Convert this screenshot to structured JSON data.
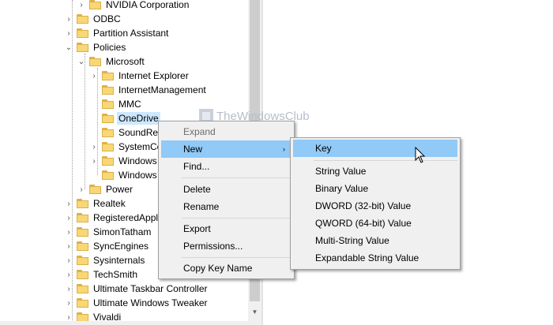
{
  "tree": {
    "items": [
      {
        "label": "NVIDIA Corporation"
      },
      {
        "label": "ODBC"
      },
      {
        "label": "Partition Assistant"
      },
      {
        "label": "Policies"
      },
      {
        "label": "Microsoft"
      },
      {
        "label": "Internet Explorer"
      },
      {
        "label": "InternetManagement"
      },
      {
        "label": "MMC"
      },
      {
        "label": "OneDrive"
      },
      {
        "label": "SoundRe"
      },
      {
        "label": "SystemCe"
      },
      {
        "label": "Windows"
      },
      {
        "label": "Windows"
      },
      {
        "label": "Power"
      },
      {
        "label": "Realtek"
      },
      {
        "label": "RegisteredAppl"
      },
      {
        "label": "SimonTatham"
      },
      {
        "label": "SyncEngines"
      },
      {
        "label": "Sysinternals"
      },
      {
        "label": "TechSmith"
      },
      {
        "label": "Ultimate Taskbar Controller"
      },
      {
        "label": "Ultimate Windows Tweaker"
      },
      {
        "label": "Vivaldi"
      }
    ],
    "chevron_collapsed": "›",
    "chevron_expanded": "⌄"
  },
  "watermark": {
    "text": "TheWindowsClub"
  },
  "context_menu": {
    "expand": "Expand",
    "new": "New",
    "find": "Find...",
    "delete": "Delete",
    "rename": "Rename",
    "export": "Export",
    "permissions": "Permissions...",
    "copy_key_name": "Copy Key Name",
    "submenu_arrow": "›"
  },
  "new_submenu": {
    "key": "Key",
    "string_value": "String Value",
    "binary_value": "Binary Value",
    "dword_value": "DWORD (32-bit) Value",
    "qword_value": "QWORD (64-bit) Value",
    "multi_string_value": "Multi-String Value",
    "expandable_string_value": "Expandable String Value"
  },
  "scrollbar": {
    "down_arrow": "▼"
  },
  "colors": {
    "highlight": "#91c9f7",
    "selection": "#cce8ff",
    "folder": "#f8d775"
  }
}
